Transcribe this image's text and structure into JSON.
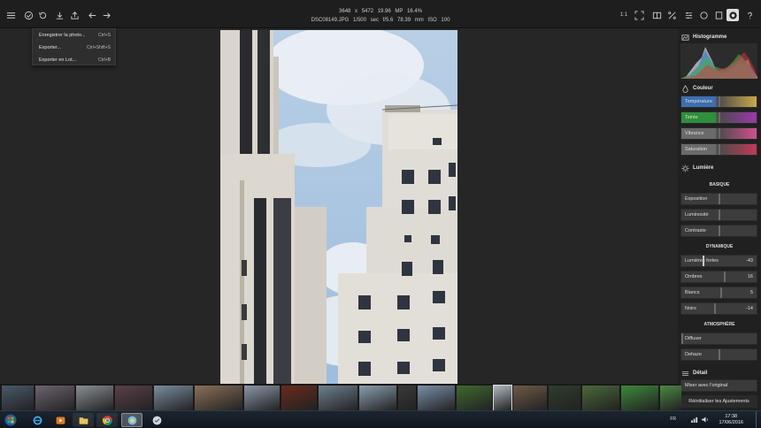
{
  "image_info": {
    "dimensions": "3648 x 5472",
    "megapixels": "19.96 MP",
    "zoom": "16.4%",
    "filename": "DSC08149.JPG",
    "shutter": "1/500 sec",
    "aperture": "f/5.6",
    "focal": "78.39 mm",
    "iso": "ISO 100"
  },
  "toolbar": {
    "zoom_1to1": "1:1"
  },
  "menu": {
    "items": [
      {
        "label": "Enregistrer la photo...",
        "shortcut": "Ctrl+S"
      },
      {
        "label": "Exporter...",
        "shortcut": "Ctrl+Shift+S"
      },
      {
        "label": "Exporter en Lot...",
        "shortcut": "Ctrl+B"
      }
    ]
  },
  "panel": {
    "histogram_title": "Histogramme",
    "color_title": "Couleur",
    "color_sliders": [
      {
        "label": "Température",
        "color_a": "#3d6fb0",
        "color_b": "#c9a84a"
      },
      {
        "label": "Teinte",
        "color_a": "#2f8f3a",
        "color_b": "#9a3aa8"
      },
      {
        "label": "Vibrance",
        "color_a": "#6a6a6a",
        "color_b": "#d05090"
      },
      {
        "label": "Saturation",
        "color_a": "#6a6a6a",
        "color_b": "#c03a5a"
      }
    ],
    "light_title": "Lumière",
    "basic_title": "BASIQUE",
    "basic_sliders": [
      {
        "label": "Exposition",
        "value": ""
      },
      {
        "label": "Luminosité",
        "value": ""
      },
      {
        "label": "Contraste",
        "value": ""
      }
    ],
    "dynamic_title": "DYNAMIQUE",
    "dynamic_sliders": [
      {
        "label": "Lumières fortes",
        "value": "-43"
      },
      {
        "label": "Ombres",
        "value": "16"
      },
      {
        "label": "Blancs",
        "value": "5"
      },
      {
        "label": "Noirs",
        "value": "-14"
      }
    ],
    "atmo_title": "ATMOSPHÈRE",
    "atmo_sliders": [
      {
        "label": "Diffuser",
        "value": ""
      },
      {
        "label": "Dehaze",
        "value": ""
      }
    ],
    "detail_title": "Détail",
    "mix_label": "Mixer avec l'original",
    "reset_label": "Réinitialiser les Ajustements"
  },
  "taskbar": {
    "lang": "FR",
    "time": "17:38",
    "date": "17/06/2016"
  },
  "thumbnails": [
    {
      "color": "#4a5a6a"
    },
    {
      "color": "#6e6470"
    },
    {
      "color": "#8a8f96"
    },
    {
      "color": "#5a4048"
    },
    {
      "color": "#7a8ea0"
    },
    {
      "color": "#8a7058"
    },
    {
      "color": "#8b98a8"
    },
    {
      "color": "#6a2a1c"
    },
    {
      "color": "#6f8190"
    },
    {
      "color": "#8aa0b0"
    },
    {
      "color": "#3a3a3a"
    },
    {
      "color": "#7890a8"
    },
    {
      "color": "#3e6a2e"
    },
    {
      "color": "#b0b8c0"
    },
    {
      "color": "#6e5a48"
    },
    {
      "color": "#2e3e2a"
    },
    {
      "color": "#4a6a38"
    },
    {
      "color": "#3d8a3a"
    },
    {
      "color": "#4a8a40"
    }
  ]
}
